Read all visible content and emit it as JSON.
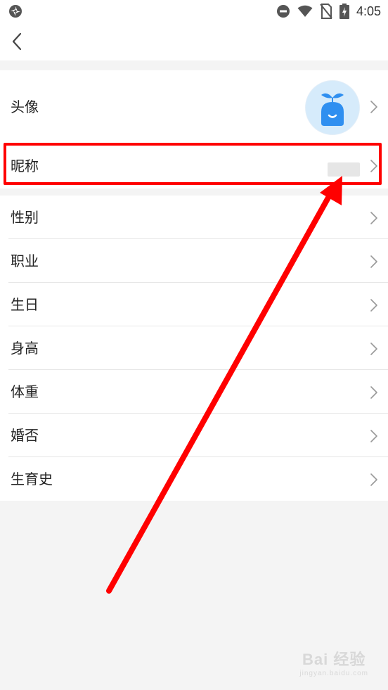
{
  "status_bar": {
    "time": "4:05"
  },
  "profile": {
    "avatar_label": "头像",
    "nickname_label": "昵称",
    "items": [
      {
        "label": "性别"
      },
      {
        "label": "职业"
      },
      {
        "label": "生日"
      },
      {
        "label": "身高"
      },
      {
        "label": "体重"
      },
      {
        "label": "婚否"
      },
      {
        "label": "生育史"
      }
    ]
  },
  "watermark": {
    "brand": "Bai 经验",
    "url": "jingyan.baidu.com"
  },
  "colors": {
    "highlight": "#ff0000",
    "avatar_bg": "#d6ebfb",
    "avatar_figure": "#2f8ff0"
  }
}
